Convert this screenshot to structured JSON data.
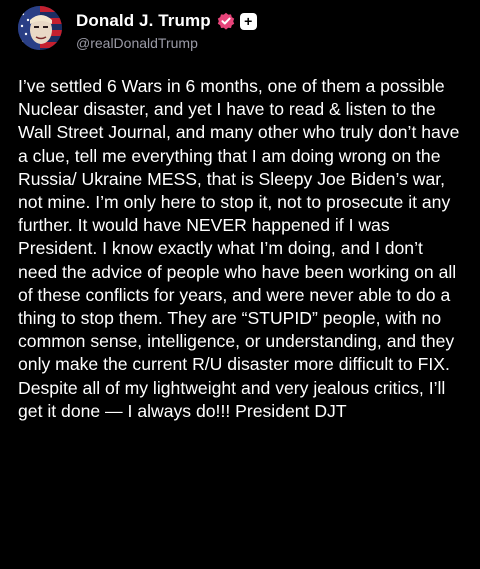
{
  "author": {
    "display_name": "Donald J. Trump",
    "handle": "@realDonaldTrump",
    "badges": [
      "verified-check-icon",
      "plus-icon"
    ],
    "plus_glyph": "+"
  },
  "post": {
    "text": "I’ve settled 6 Wars in 6 months, one of them a possible Nuclear disaster, and yet I have to read & listen to the Wall Street Journal, and many other who truly don’t have a clue, tell me everything that I am doing wrong on the Russia/ Ukraine MESS, that is Sleepy Joe Biden’s war, not mine. I’m only here to stop it, not to prosecute it any further. It would have NEVER happened if I was President. I know exactly what I’m doing, and I don’t need the advice of people who have been working on all of these conflicts for years, and were never able to do a thing to stop them. They are “STUPID” people, with no common sense, intelligence, or understanding, and they only make the current R/U disaster more difficult to FIX. Despite all of my lightweight and very jealous critics, I’ll get it done — I always do!!! President DJT"
  },
  "colors": {
    "background": "#000000",
    "text": "#ffffff",
    "handle": "#9a9aa6",
    "verified_badge": "#e8447a"
  }
}
